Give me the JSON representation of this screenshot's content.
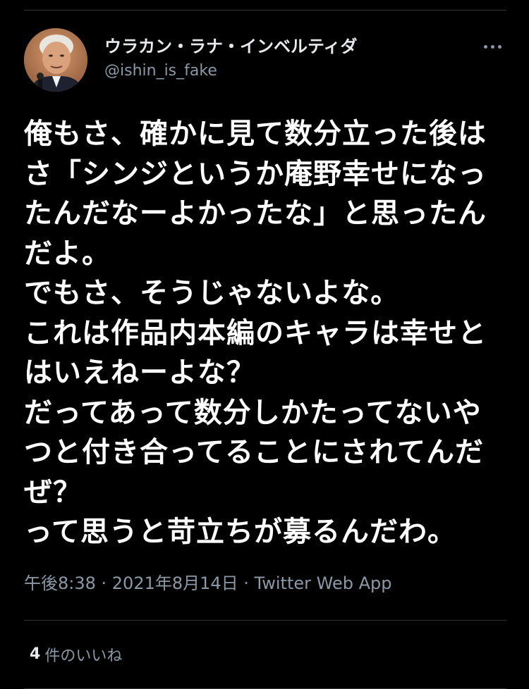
{
  "tweet": {
    "display_name": "ウラカン・ラナ・インベルティダ",
    "handle": "@ishin_is_fake",
    "body_lines": [
      "俺もさ、確かに見て数分立った後は",
      "さ「シンジというか庵野幸せになっ",
      "たんだなーよかったな」と思ったん",
      "だよ。",
      "でもさ、そうじゃないよな。",
      "これは作品内本編のキャラは幸せと",
      "はいえねーよな？",
      "だってあって数分しかたってないや",
      "つと付き合ってることにされてんだ",
      "ぜ？",
      "って思うと苛立ちが募るんだわ。"
    ],
    "meta": "午後8:38 · 2021年8月14日 · Twitter Web App",
    "likes_count": "4",
    "likes_label": "件のいいね"
  },
  "colors": {
    "background": "#000000",
    "text": "#ffffff",
    "secondary": "#8b98a5",
    "divider": "#2f3336"
  },
  "icons": {
    "more": "more-options-icon",
    "avatar": "profile-photo"
  }
}
